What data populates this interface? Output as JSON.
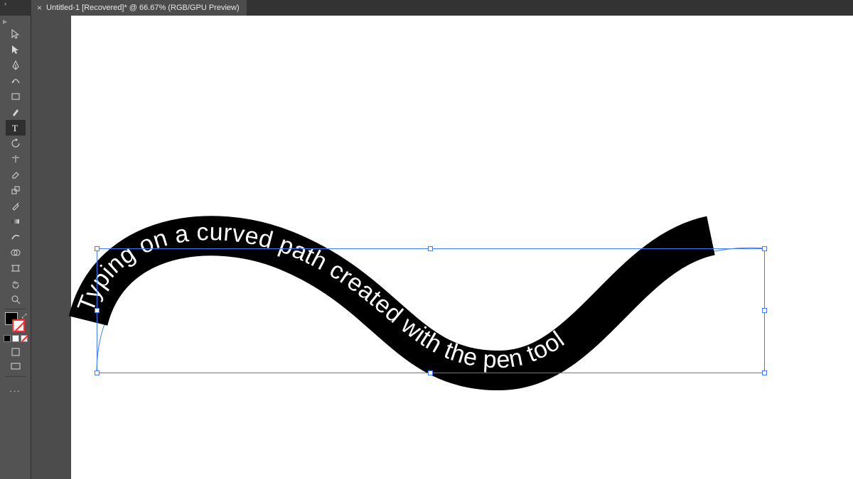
{
  "tab": {
    "title": "Untitled-1 [Recovered]* @ 66.67% (RGB/GPU Preview)",
    "close_glyph": "×"
  },
  "expand_glyph": "››",
  "tools": [
    {
      "id": "selection-tool",
      "label": "Selection"
    },
    {
      "id": "direct-selection-tool",
      "label": "Direct Selection"
    },
    {
      "id": "pen-tool",
      "label": "Pen"
    },
    {
      "id": "curvature-tool",
      "label": "Curvature"
    },
    {
      "id": "rectangle-tool",
      "label": "Rectangle"
    },
    {
      "id": "paintbrush-tool",
      "label": "Paintbrush"
    },
    {
      "id": "type-tool",
      "label": "Type",
      "active": true
    },
    {
      "id": "rotate-tool",
      "label": "Rotate"
    },
    {
      "id": "reflect-tool",
      "label": "Reflect"
    },
    {
      "id": "eraser-tool",
      "label": "Eraser"
    },
    {
      "id": "scale-tool",
      "label": "Scale"
    },
    {
      "id": "eyedropper-tool",
      "label": "Eyedropper"
    },
    {
      "id": "gradient-tool",
      "label": "Gradient"
    },
    {
      "id": "free-transform-tool",
      "label": "Free Transform"
    },
    {
      "id": "shape-builder-tool",
      "label": "Shape Builder"
    },
    {
      "id": "artboard-tool",
      "label": "Artboard"
    },
    {
      "id": "hand-tool",
      "label": "Hand"
    },
    {
      "id": "zoom-tool",
      "label": "Zoom"
    }
  ],
  "swatch": {
    "fill": "#000000",
    "stroke": "none"
  },
  "artwork": {
    "path_text": "Typing on a curved path created with the pen tool",
    "stroke_color": "#000000",
    "text_color": "#ffffff",
    "selection_color": "#3e7bff"
  },
  "more_glyph": "..."
}
